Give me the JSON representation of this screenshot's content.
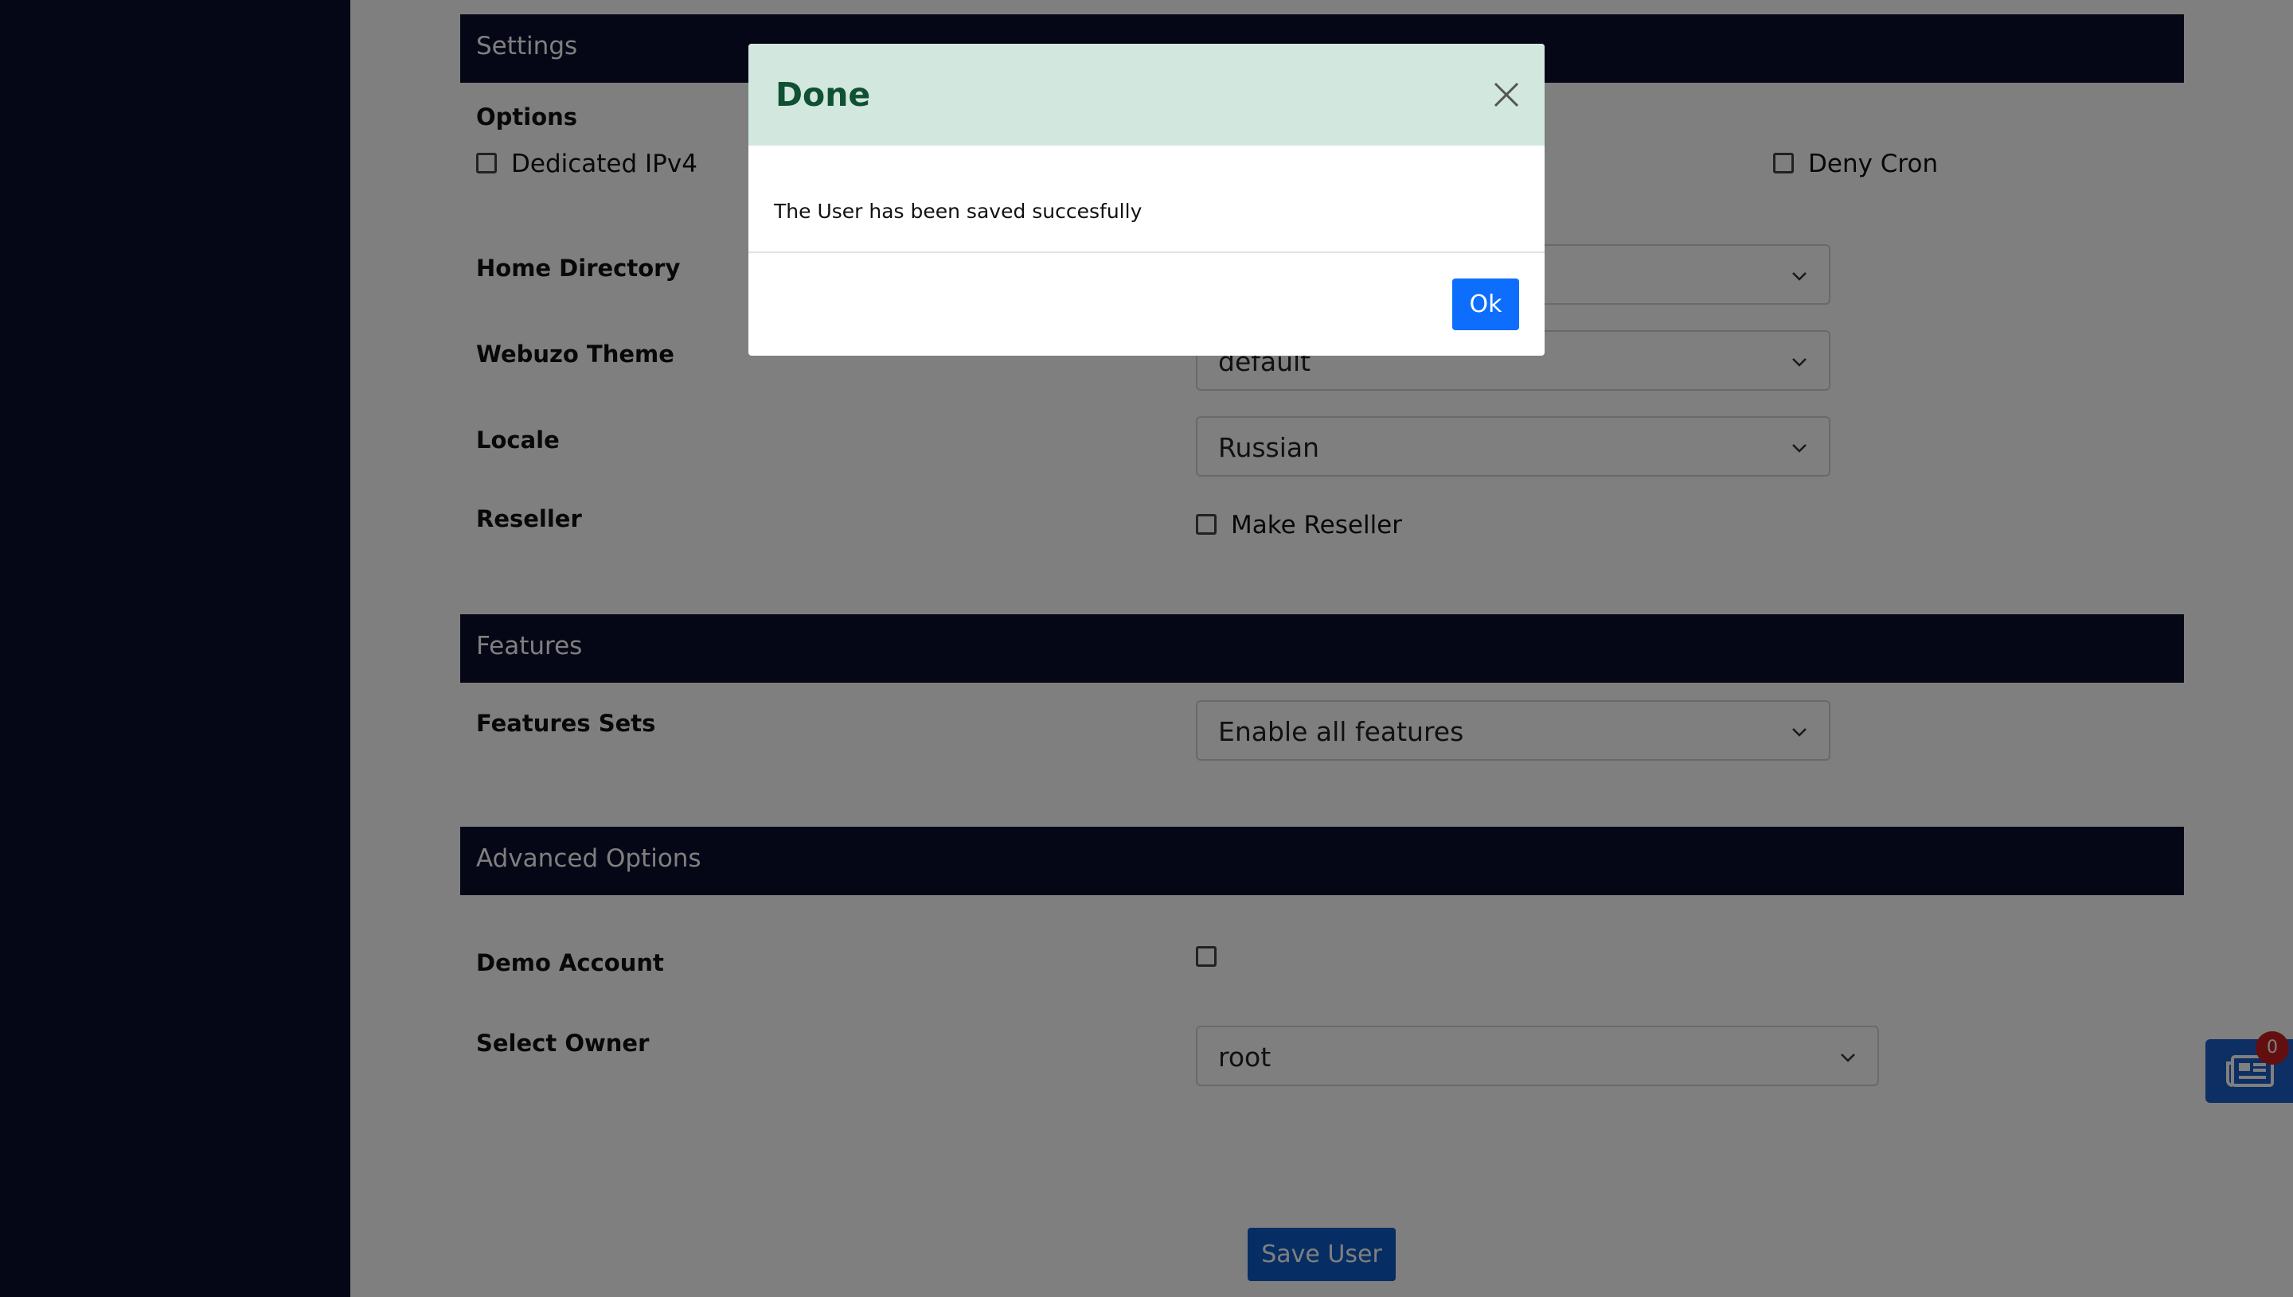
{
  "settings": {
    "title": "Settings",
    "options_label": "Options",
    "dedicated_ipv4_label": "Dedicated IPv4",
    "deny_cron_label": "Deny Cron",
    "home_directory_label": "Home Directory",
    "webuzo_theme_label": "Webuzo Theme",
    "webuzo_theme_value": "default",
    "locale_label": "Locale",
    "locale_value": "Russian",
    "reseller_label": "Reseller",
    "make_reseller_label": "Make Reseller"
  },
  "features": {
    "title": "Features",
    "features_sets_label": "Features Sets",
    "features_sets_value": "Enable all features"
  },
  "advanced": {
    "title": "Advanced Options",
    "demo_account_label": "Demo Account",
    "select_owner_label": "Select Owner",
    "select_owner_value": "root"
  },
  "save_button_label": "Save User",
  "news_badge_count": "0",
  "modal": {
    "title": "Done",
    "message": "The User has been saved succesfully",
    "ok_label": "Ok"
  },
  "colors": {
    "panel_header": "#0a0f2e",
    "modal_header": "#d2e7de",
    "modal_title": "#0f5132",
    "primary_button": "#0d6efd",
    "badge": "#c81e1e"
  }
}
